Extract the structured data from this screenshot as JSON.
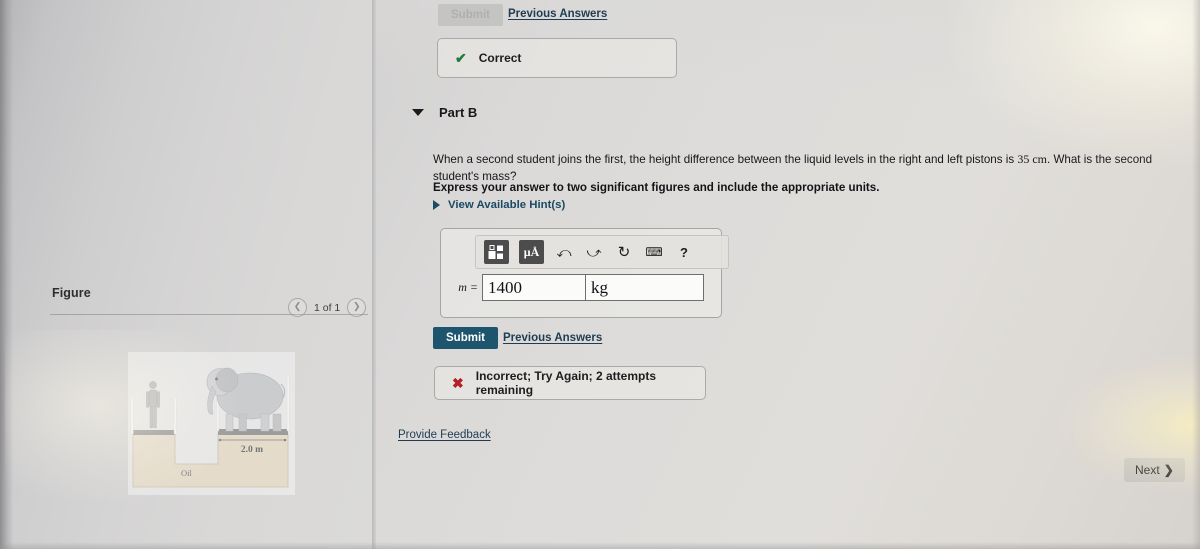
{
  "figure_panel": {
    "title": "Figure",
    "nav": {
      "prev_icon": "chevron-left-icon",
      "counter": "1 of 1",
      "next_icon": "chevron-right-icon"
    },
    "illustration": {
      "alt": "hydraulic-lift-with-person-and-elephant",
      "liquid_label": "Oil",
      "dimension_label": "2.0 m"
    }
  },
  "part_a": {
    "submit_label": "Submit",
    "previous_answers_label": "Previous Answers",
    "result_icon": "check-icon",
    "result_text": "Correct",
    "result_color": "#1f7a3d"
  },
  "part_b": {
    "caret_icon": "caret-down-icon",
    "title": "Part B",
    "question_main": "When a second student joins the first, the height difference between the liquid levels in the right and left pistons is",
    "question_value": "35 cm",
    "question_tail": ". What is the second student's mass?",
    "instruction": "Express your answer to two significant figures and include the appropriate units.",
    "hints": {
      "caret_icon": "caret-right-icon",
      "label": "View Available Hint(s)"
    },
    "answer": {
      "toolbar": [
        {
          "name": "math-template-icon",
          "glyph": "▣"
        },
        {
          "name": "units-icon",
          "glyph": "μÅ"
        },
        {
          "name": "undo-icon",
          "glyph": "↶"
        },
        {
          "name": "redo-icon",
          "glyph": "↷"
        },
        {
          "name": "reset-icon",
          "glyph": "↺"
        },
        {
          "name": "keyboard-icon",
          "glyph": "⌨"
        },
        {
          "name": "help-icon",
          "glyph": "?"
        }
      ],
      "variable_label": "m =",
      "value": "1400",
      "unit": "kg"
    },
    "submit_label": "Submit",
    "previous_answers_label": "Previous Answers",
    "result_icon": "cross-icon",
    "result_text": "Incorrect; Try Again; 2 attempts remaining",
    "result_color": "#b32027"
  },
  "footer": {
    "feedback_label": "Provide Feedback",
    "next_label": "Next",
    "next_icon": "chevron-right-icon"
  }
}
